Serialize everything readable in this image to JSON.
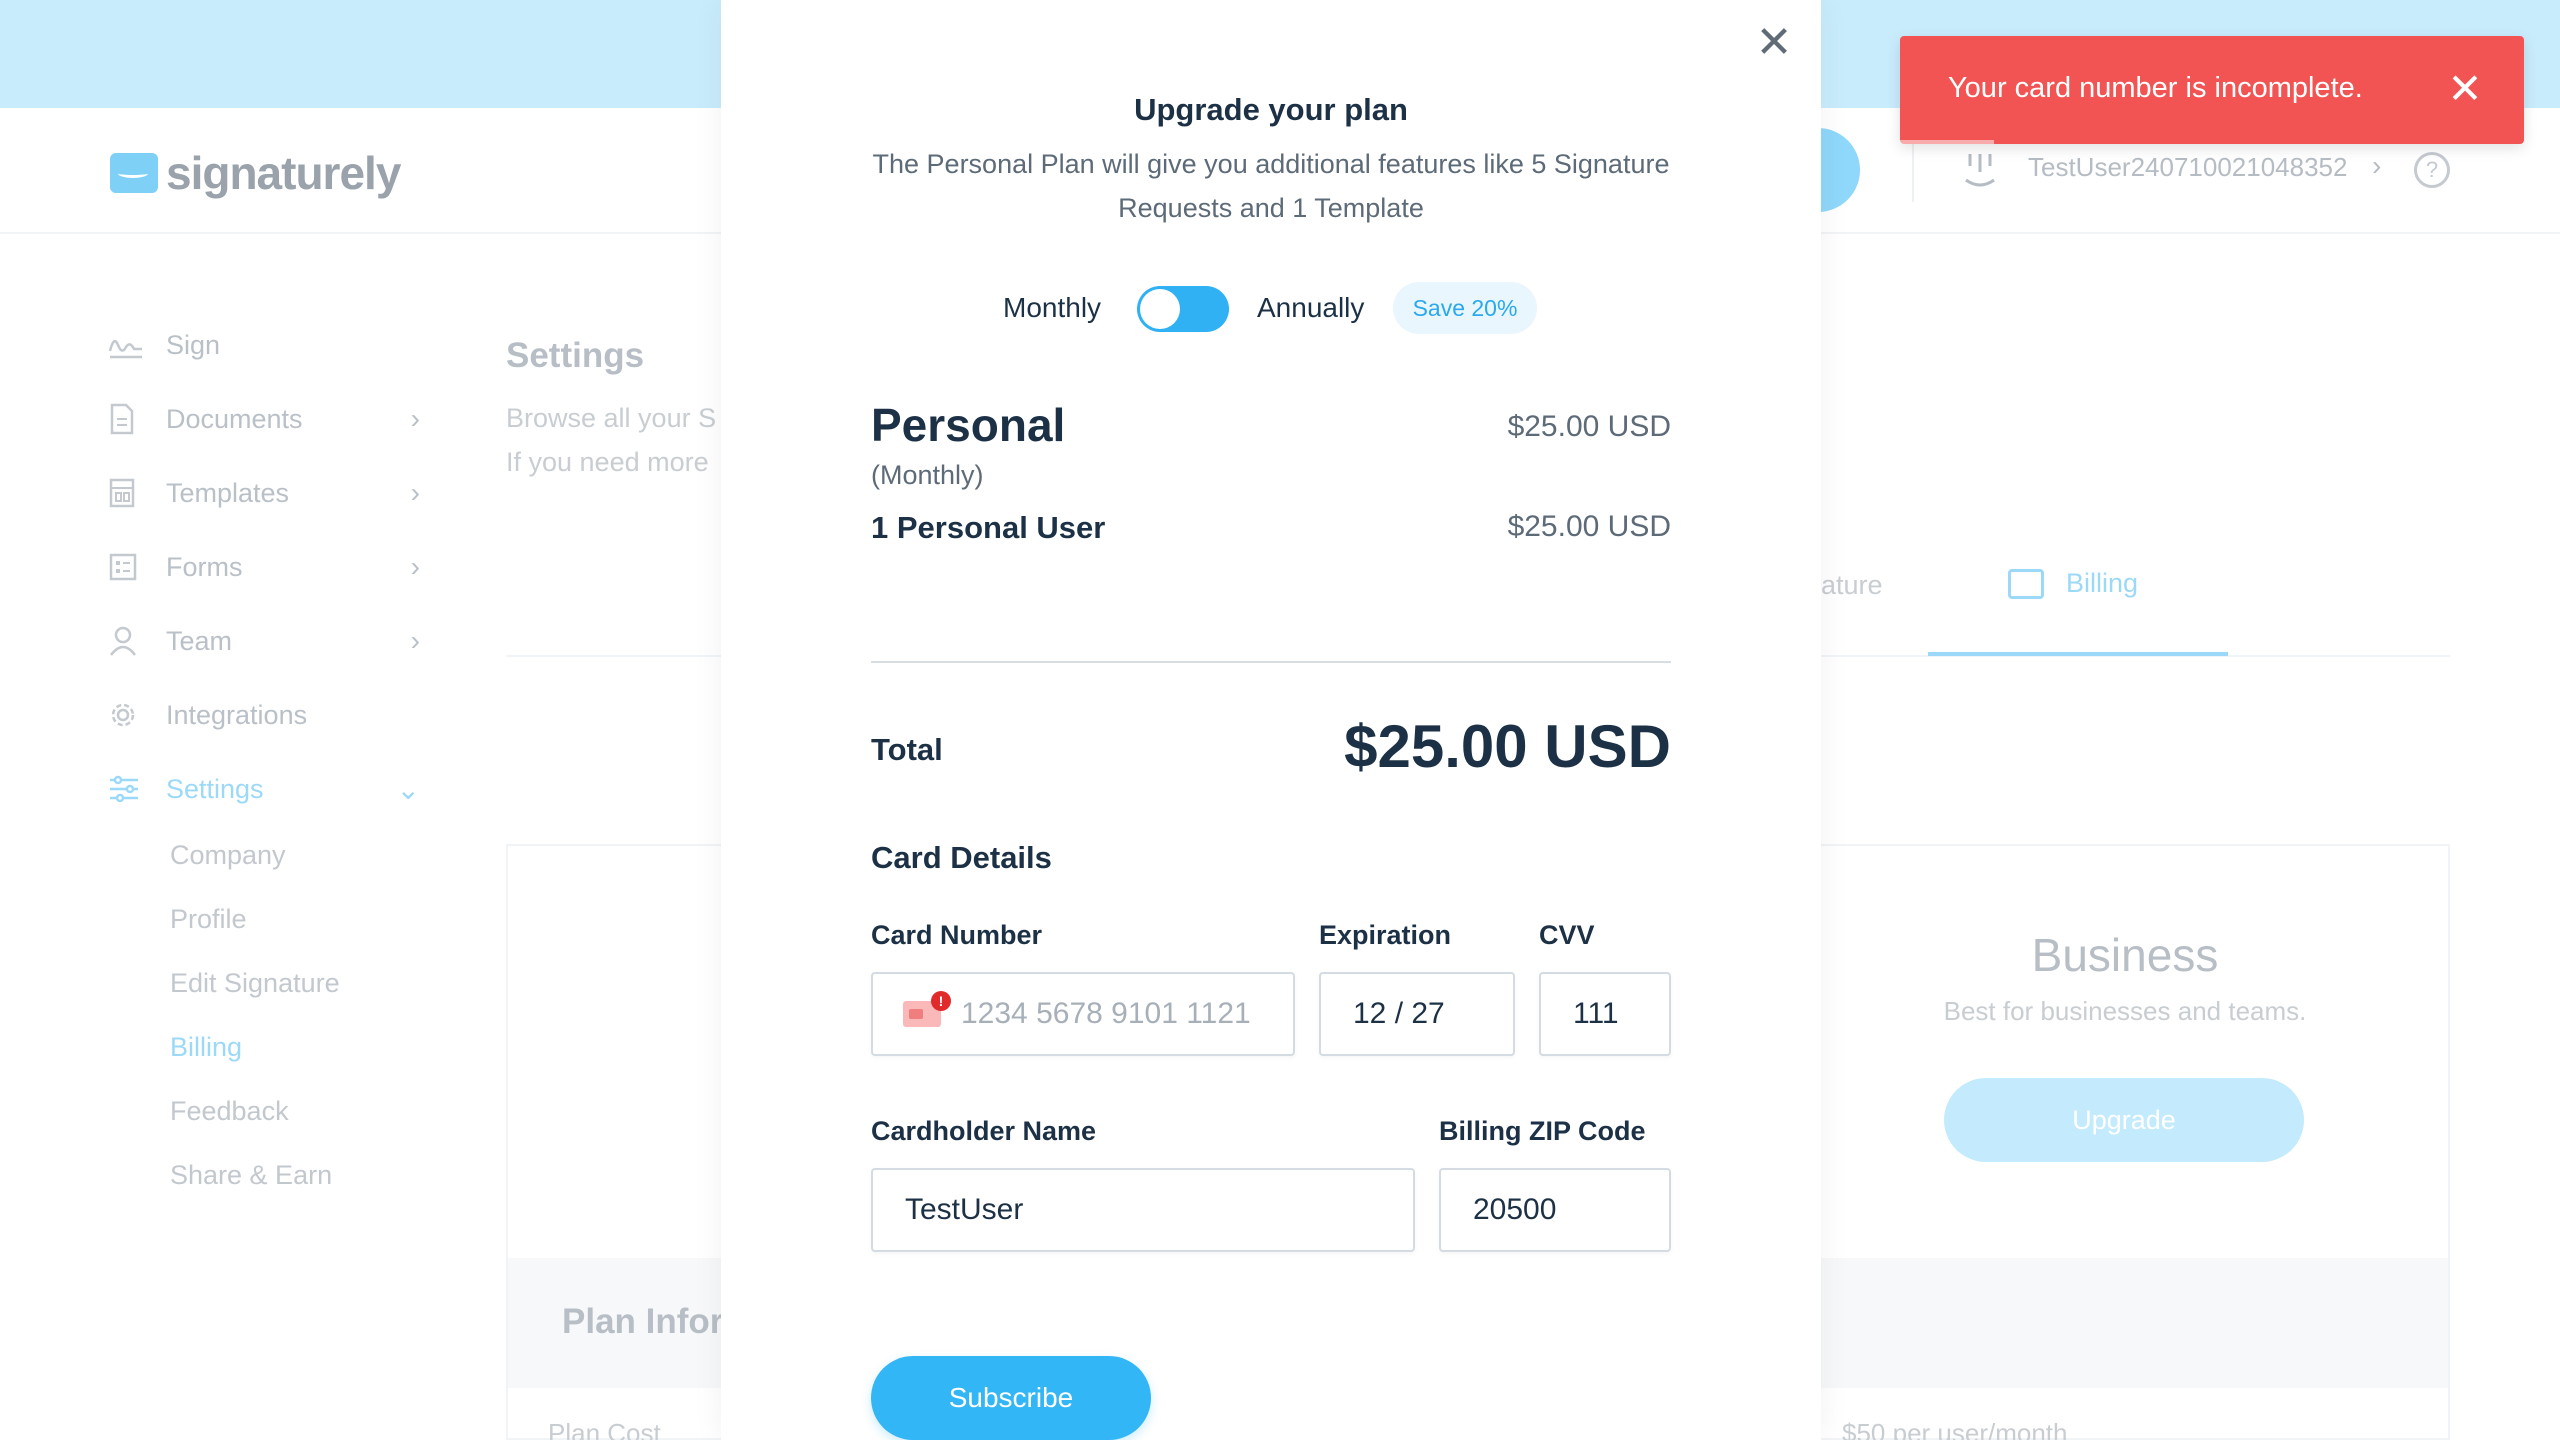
{
  "brand": {
    "name": "signaturely"
  },
  "header": {
    "username": "TestUser240710021048352",
    "help_glyph": "?"
  },
  "sidebar": {
    "items": [
      {
        "label": "Sign",
        "icon": "signature-icon"
      },
      {
        "label": "Documents",
        "icon": "document-icon"
      },
      {
        "label": "Templates",
        "icon": "template-icon"
      },
      {
        "label": "Forms",
        "icon": "form-icon"
      },
      {
        "label": "Team",
        "icon": "user-icon"
      },
      {
        "label": "Integrations",
        "icon": "gear-icon"
      },
      {
        "label": "Settings",
        "icon": "sliders-icon"
      }
    ],
    "settings_sub": [
      "Company",
      "Profile",
      "Edit Signature",
      "Billing",
      "Feedback",
      "Share & Earn"
    ]
  },
  "page": {
    "title": "Settings",
    "desc_line1": "Browse all your S",
    "desc_line2": "If you need more",
    "tab_signature_partial": "nature",
    "tab_billing": "Billing",
    "business_title": "Business",
    "business_desc": "Best for businesses and teams.",
    "business_button": "Upgrade",
    "plan_info_title": "Plan Infor",
    "plan_cost_label": "Plan Cost",
    "plan_cost_value": "$50 per user/month"
  },
  "modal": {
    "title": "Upgrade your plan",
    "subtitle": "The Personal Plan will give you additional features like 5 Signature Requests and 1 Template",
    "toggle": {
      "monthly": "Monthly",
      "annually": "Annually",
      "save_badge": "Save 20%"
    },
    "plan": {
      "name": "Personal",
      "period": "(Monthly)",
      "price": "$25.00 USD",
      "line_label": "1 Personal User",
      "line_price": "$25.00 USD"
    },
    "total_label": "Total",
    "total_value": "$25.00 USD",
    "card_details_title": "Card Details",
    "fields": {
      "card_number_label": "Card Number",
      "card_number_placeholder": "1234 5678 9101 1121",
      "expiration_label": "Expiration",
      "expiration_value": "12 / 27",
      "cvv_label": "CVV",
      "cvv_value": "111",
      "cardholder_label": "Cardholder Name",
      "cardholder_value": "TestUser",
      "zip_label": "Billing ZIP Code",
      "zip_value": "20500"
    },
    "subscribe_label": "Subscribe"
  },
  "toast": {
    "message": "Your card number is incomplete."
  },
  "colors": {
    "accent": "#33b6f5",
    "toast_error": "#f25454",
    "text_dark": "#1d3146"
  }
}
